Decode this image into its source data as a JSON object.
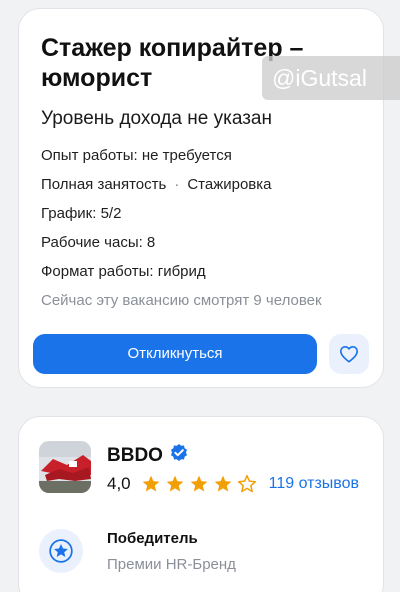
{
  "vacancy": {
    "title": "Стажер копирайтер – юморист",
    "salary": "Уровень дохода не указан",
    "experience": "Опыт работы: не требуется",
    "employment_type": "Полная занятость",
    "separator": "·",
    "employment_kind": "Стажировка",
    "schedule": "График: 5/2",
    "hours": "Рабочие часы: 8",
    "work_format": "Формат работы: гибрид",
    "viewers": "Сейчас эту вакансию смотрят 9 человек",
    "apply_label": "Откликнуться",
    "favorite_icon": "heart-icon"
  },
  "watermark": "@iGutsal",
  "employer": {
    "name": "BBDO",
    "verified_icon": "verified-badge-icon",
    "rating": "4,0",
    "rating_value": 4,
    "rating_max": 5,
    "reviews": "119 отзывов",
    "award_title": "Победитель",
    "award_subtitle": "Премии HR-Бренд",
    "award_icon": "star-badge-icon"
  },
  "colors": {
    "accent": "#1a73e8",
    "star": "#f2a007",
    "light_accent": "#eaf1fd"
  }
}
